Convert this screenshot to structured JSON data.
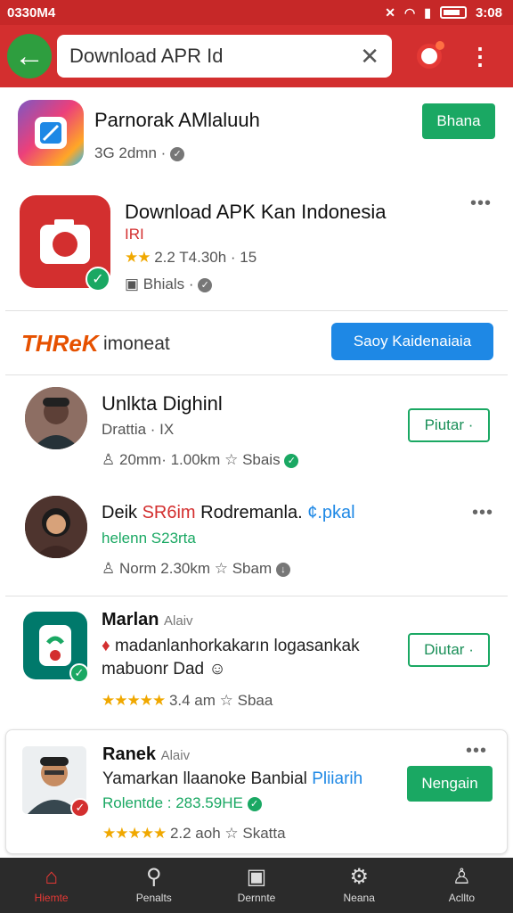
{
  "status": {
    "time": "0330M4",
    "right_time": "3:08"
  },
  "toolbar": {
    "search_value": "Download APR Id"
  },
  "cards": [
    {
      "title": "Parnorak AMlaluuh",
      "meta": "3G 2dmn ·",
      "button": "Bhana"
    },
    {
      "title": "Download APK Kan Indonesia",
      "sub": "IRI",
      "rating_line": "2.2  T4.30h · 15",
      "publisher": "Bhials ·"
    },
    {
      "brand_logo": "THReK",
      "brand_text": "imoneat",
      "button": "Saoy Kaidenaiaia"
    },
    {
      "title": "Unlkta Dighinl",
      "sub": "Drattia · IX",
      "stats": "20mm·  1.00km",
      "source": "Sbais",
      "button": "Piutar ·"
    },
    {
      "title_a": "Deik",
      "title_red": "SR6im",
      "title_b": "Rodremanla.",
      "title_blue": "¢.pkal",
      "sub": "helenn S23rta",
      "stats": "Norm   2.30km",
      "source": "Sbam"
    },
    {
      "title": "Marlan",
      "title_tag": "Alaiv",
      "line1": "madanlanhorkakarın logasankak",
      "line2": "mabuonr Dad",
      "stats": "3.4 am",
      "source": "Sbaa",
      "button": "Diutar ·"
    },
    {
      "title": "Ranek",
      "title_tag": "Alaiv",
      "line1_a": "Yamarkan llaanoke Banbial",
      "line1_blue": "Pliiarih",
      "line2": "Rolentde : 283.59HE",
      "stats": "2.2 aoh",
      "source": "Skatta",
      "button": "Nengain"
    }
  ],
  "nav": [
    {
      "label": "Hiemte",
      "icon": "home-icon"
    },
    {
      "label": "Penalts",
      "icon": "search-icon"
    },
    {
      "label": "Dernnte",
      "icon": "apps-icon"
    },
    {
      "label": "Neana",
      "icon": "settings-icon"
    },
    {
      "label": "Acllto",
      "icon": "account-icon"
    }
  ],
  "colors": {
    "toolbar": "#d32f2f",
    "accent_green": "#1aa863",
    "button_blue": "#1e88e5"
  }
}
